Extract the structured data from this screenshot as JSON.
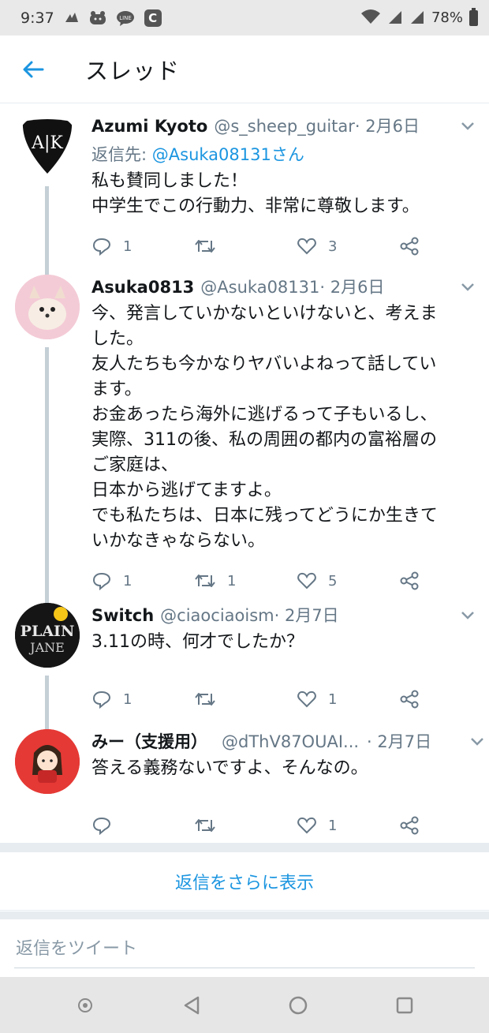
{
  "status_bar": {
    "time": "9:37",
    "notification_icons": [
      "bird-icon",
      "face-icon",
      "line-app-icon",
      "c-app-icon"
    ],
    "line_label": "LINE",
    "c_label": "C",
    "battery": "78%"
  },
  "header": {
    "title": "スレッド"
  },
  "tweets": [
    {
      "name": "Azumi Kyoto",
      "handle": "@s_sheep_guitar",
      "date": " · 2月6日",
      "reply_prefix": "返信先: ",
      "reply_mention": "@Asuka08131さん",
      "lines": [
        "私も賛同しました！",
        "中学生でこの行動力、非常に尊敬します。"
      ],
      "replies": "1",
      "retweets": "",
      "likes": "3",
      "avatar_text": "A|K"
    },
    {
      "name": "Asuka0813",
      "handle": "@Asuka08131",
      "date": " · 2月6日",
      "lines": [
        "今、発言していかないといけないと、考えま",
        "した。",
        "友人たちも今かなりヤバいよねって話してい",
        "ます。",
        "お金あったら海外に逃げるって子もいるし、",
        "実際、311の後、私の周囲の都内の富裕層の",
        "ご家庭は、",
        "日本から逃げてますよ。",
        "でも私たちは、日本に残ってどうにか生きて",
        "いかなきゃならない。"
      ],
      "replies": "1",
      "retweets": "1",
      "likes": "5"
    },
    {
      "name": "Switch",
      "handle": "@ciaociaoism",
      "date": " · 2月7日",
      "lines": [
        "3.11の時、何才でしたか？"
      ],
      "replies": "1",
      "retweets": "",
      "likes": "1",
      "avatar_text_top": "PLAIN",
      "avatar_text_bottom": "JANE"
    },
    {
      "name": "みー（支援用）",
      "handle": "@dThV87OUAI...",
      "date": " · 2月7日",
      "lines": [
        "答える義務ないですよ、そんなの。"
      ],
      "replies": "",
      "retweets": "",
      "likes": "1"
    }
  ],
  "more_replies": "返信をさらに表示",
  "compose": {
    "placeholder": "返信をツイート"
  },
  "colors": {
    "accent": "#1b95e0",
    "secondary_text": "#657786",
    "thread_line": "#c4cfd6",
    "status_bar_bg": "#e9e9e9"
  }
}
